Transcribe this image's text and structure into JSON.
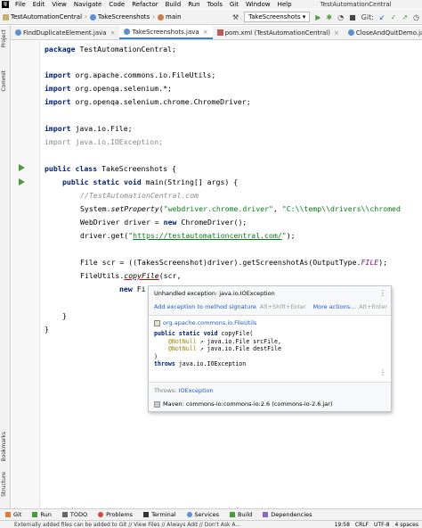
{
  "menubar": {
    "items": [
      "File",
      "Edit",
      "View",
      "Navigate",
      "Code",
      "Refactor",
      "Build",
      "Run",
      "Tools",
      "Git",
      "Window",
      "Help"
    ],
    "window_title": "TestAutomationCentral"
  },
  "navbar": {
    "crumbs": [
      "TestAutomationCentral",
      "TakeScreenshots",
      "main"
    ],
    "run_config": "TakeScreenshots",
    "git_label": "Git:"
  },
  "tabs": [
    "FindDuplicateElement.java",
    "TakeScreenshots.java",
    "pom.xml (TestAutomationCentral)",
    "CloseAndQuitDemo.java"
  ],
  "left_strip": {
    "project": "Project",
    "commit": "Commit",
    "bookmarks": "Bookmarks",
    "structure": "Structure"
  },
  "code": {
    "l1_kw": "package",
    "l1_rest": " TestAutomationCentral;",
    "imp": "import",
    "imp1": " org.apache.commons.io.FileUtils;",
    "imp2": " org.openqa.selenium.*;",
    "imp3": " org.openqa.selenium.chrome.ChromeDriver;",
    "imp4": " java.io.File;",
    "imp5": " java.io.IOException;",
    "cls_kw": "public class",
    "cls_rest": " TakeScreenshots {",
    "main_kw": "public static void",
    "main_rest": " main(String[] args) {",
    "comment": "//TestAutomationCentral.com",
    "sys_a": "System.",
    "sys_b": "setProperty",
    "sys_c": "(",
    "sys_str1": "\"webdriver.chrome.driver\"",
    "sys_d": ", ",
    "sys_str2": "\"C:\\\\temp\\\\drivers\\\\chromed",
    "drv_a": "WebDriver driver = ",
    "drv_kw": "new",
    "drv_b": " ChromeDriver();",
    "get_a": "driver.get(",
    "get_str1": "\"",
    "get_url": "https://testautomationcentral.com/",
    "get_str2": "\"",
    "get_b": ");",
    "scr_a": "File scr = ((TakesScreenshot)driver).getScreenshotAs(OutputType.",
    "scr_cst": "FILE",
    "scr_b": ");",
    "fu_a": "FileUtils.",
    "fu_b": "copyFile",
    "fu_c": "(scr,",
    "new_kw": "new",
    "new_rest": " Fi",
    "close1": "}",
    "close2": "}"
  },
  "popup": {
    "header": "Unhandled exception: java.io.IOException",
    "action1": "Add exception to method signature",
    "action1_shortcut": "Alt+Shift+Enter",
    "action2": "More actions...",
    "action2_shortcut": "Alt+Enter",
    "doc_path": "org.apache.commons.io.FileUtils",
    "sig1_kw": "public static void",
    "sig1_rest": " copyFile(",
    "sig2_ann": "@NotNull",
    "sig2_rest": " java.io.File srcFile,",
    "sig3_ann": "@NotNull",
    "sig3_rest": " java.io.File destFile",
    "sig4_rest": ")",
    "sig5_kw": "throws",
    "sig5_rest": " java.io.IOException",
    "throws_label": "Throws:",
    "throws_value": "IOException",
    "maven": "Maven: commons-io:commons-io:2.6 (commons-io-2.6.jar)"
  },
  "bottom_tools": [
    "Git",
    "Run",
    "TODO",
    "Problems",
    "Terminal",
    "Services",
    "Build",
    "Dependencies"
  ],
  "status": {
    "message": "Externally added files can be added to Git // View Files // Always Add // Don't Ask A...",
    "position": "19:58",
    "line_sep": "CRLF",
    "encoding": "UTF-8",
    "indent": "4 spaces"
  },
  "colors": {
    "keyword": "#00207a",
    "string": "#067d17",
    "comment": "#8c8c8c",
    "link": "#2457c5",
    "run_green": "#4a9b3a",
    "tab_accent": "#4083c9"
  }
}
